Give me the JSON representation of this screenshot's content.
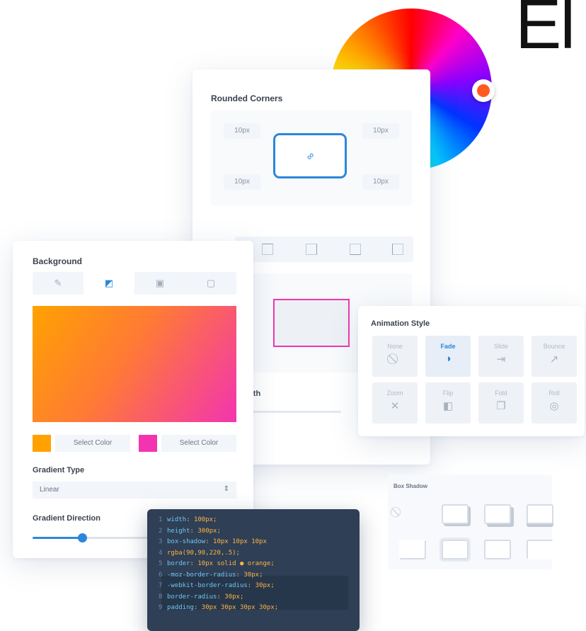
{
  "brand_text": "El",
  "colors": {
    "accent_blue": "#2b87da",
    "pink": "#f334b0",
    "orange": "#ffa200",
    "handle": "#ff5a1f"
  },
  "rounded_corners": {
    "title": "Rounded Corners",
    "tl": "10px",
    "tr": "10px",
    "bl": "10px",
    "br": "10px"
  },
  "middle_panel": {
    "partial_label": "idth"
  },
  "background": {
    "title": "Background",
    "tabs": [
      "color",
      "gradient",
      "image",
      "video"
    ],
    "gradient_colors": [
      "#ffa200",
      "#f334b0"
    ],
    "select_color_1": "Select Color",
    "select_color_2": "Select Color",
    "gradient_type_label": "Gradient Type",
    "gradient_type_value": "Linear",
    "gradient_direction_label": "Gradient Direction",
    "gradient_direction_value": 0.25
  },
  "animation": {
    "title": "Animation Style",
    "tiles": [
      {
        "label": "None",
        "icon": "⃠"
      },
      {
        "label": "Fade",
        "icon": "◑"
      },
      {
        "label": "Slide",
        "icon": "⇥"
      },
      {
        "label": "Bounce",
        "icon": "↗"
      },
      {
        "label": "Zoom",
        "icon": "✕"
      },
      {
        "label": "Flip",
        "icon": "◧"
      },
      {
        "label": "Fold",
        "icon": "❐"
      },
      {
        "label": "Roll",
        "icon": "◎"
      }
    ]
  },
  "box_shadow": {
    "title": "Box Shadow"
  },
  "code": [
    {
      "n": "1",
      "prop": "width",
      "val": "100px;"
    },
    {
      "n": "2",
      "prop": "height",
      "val": "300px;"
    },
    {
      "n": "3",
      "prop": "box-shadow",
      "val": "10px 10px 10px"
    },
    {
      "n": "4",
      "prop": "",
      "val": "rgba(90,90,220,.5);"
    },
    {
      "n": "5",
      "prop": "border",
      "val": "10px solid ● orange;"
    },
    {
      "n": "6",
      "prop": "-moz-border-radius",
      "val": "30px;"
    },
    {
      "n": "7",
      "prop": "-webkit-border-radius",
      "val": "30px;"
    },
    {
      "n": "8",
      "prop": "border-radius",
      "val": "30px;"
    },
    {
      "n": "9",
      "prop": "padding",
      "val": "30px 30px 30px 30px;"
    }
  ]
}
